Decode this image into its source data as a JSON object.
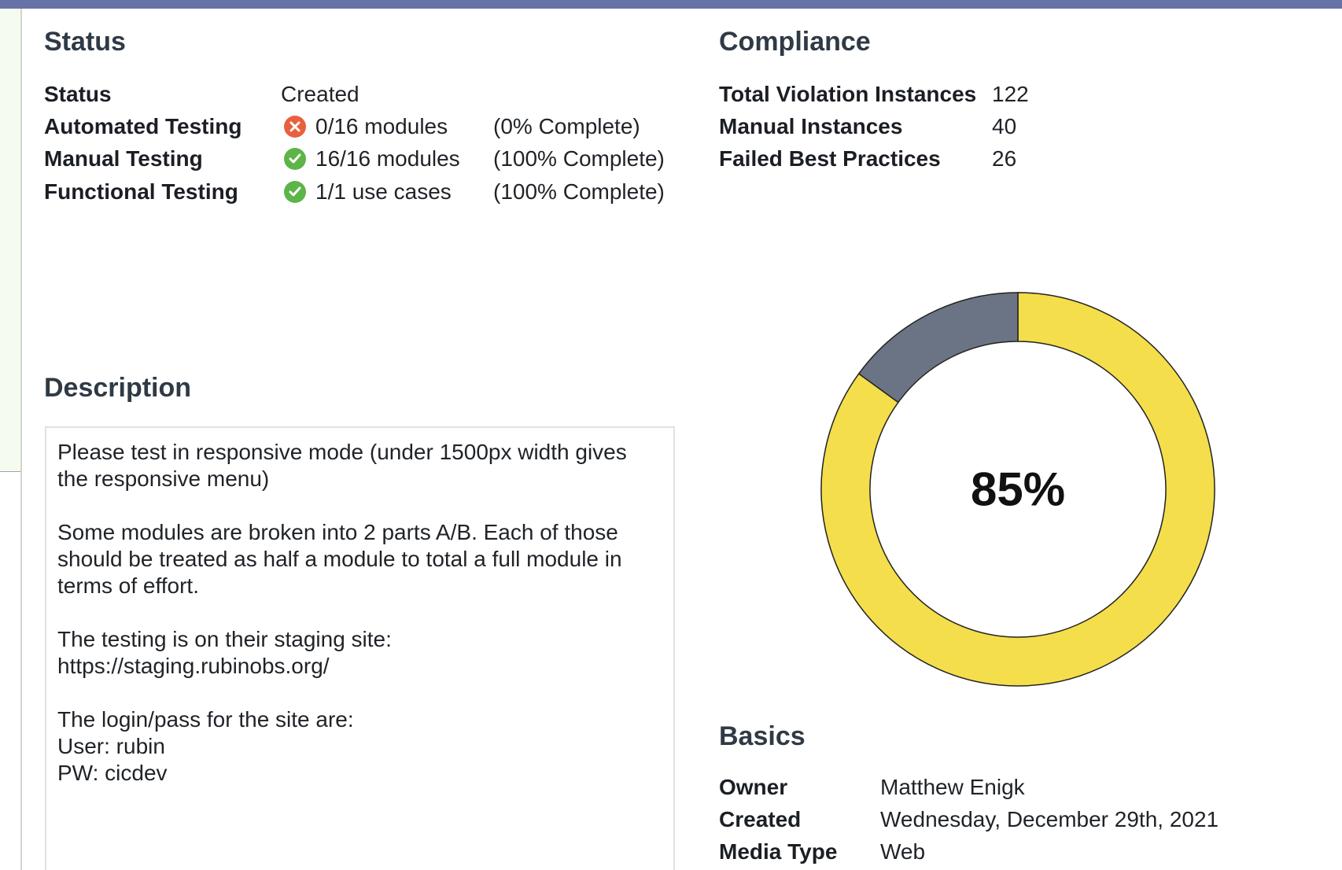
{
  "status": {
    "heading": "Status",
    "rows": [
      {
        "label": "Status",
        "value": "Created"
      },
      {
        "label": "Automated Testing",
        "value": "0/16 modules",
        "percent": "(0% Complete)",
        "state": "fail"
      },
      {
        "label": "Manual Testing",
        "value": "16/16 modules",
        "percent": "(100% Complete)",
        "state": "ok"
      },
      {
        "label": "Functional Testing",
        "value": "1/1 use cases",
        "percent": "(100% Complete)",
        "state": "ok"
      }
    ]
  },
  "compliance": {
    "heading": "Compliance",
    "rows": [
      {
        "label": "Total Violation Instances",
        "value": "122"
      },
      {
        "label": "Manual Instances",
        "value": "40"
      },
      {
        "label": "Failed Best Practices",
        "value": "26"
      }
    ]
  },
  "description": {
    "heading": "Description",
    "lines": [
      "Please test in responsive mode (under 1500px width gives",
      "the responsive menu)",
      "",
      "Some modules are broken into 2 parts A/B. Each of those",
      "should be treated as half a module to total a full module in",
      "terms of effort.",
      "",
      "The testing is on their staging site:",
      "https://staging.rubinobs.org/",
      "",
      "The login/pass for the site are:",
      "User: rubin",
      "PW: cicdev"
    ]
  },
  "chart_data": {
    "type": "pie",
    "label": "85%",
    "slices": [
      {
        "value": 85,
        "color": "#f4de4b"
      },
      {
        "value": 15,
        "color": "#6b7485"
      }
    ]
  },
  "basics": {
    "heading": "Basics",
    "rows": [
      {
        "label": "Owner",
        "value": "Matthew Enigk"
      },
      {
        "label": "Created",
        "value": "Wednesday, December 29th, 2021"
      },
      {
        "label": "Media Type",
        "value": "Web"
      }
    ]
  },
  "colors": {
    "top_bar": "#6672a8",
    "fail": "#e8613f",
    "ok": "#5db448"
  }
}
